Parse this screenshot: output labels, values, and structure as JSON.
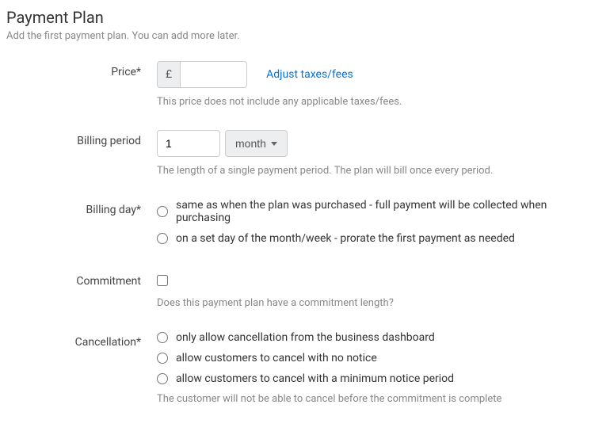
{
  "header": {
    "title": "Payment Plan",
    "subtitle": "Add the first payment plan. You can add more later."
  },
  "price": {
    "label": "Price*",
    "currency": "£",
    "value": "",
    "adjust_link": "Adjust taxes/fees",
    "helper": "This price does not include any applicable taxes/fees."
  },
  "billing_period": {
    "label": "Billing period",
    "value": "1",
    "unit": "month",
    "helper": "The length of a single payment period. The plan will bill once every period."
  },
  "billing_day": {
    "label": "Billing day*",
    "options": [
      "same as when the plan was purchased - full payment will be collected when purchasing",
      "on a set day of the month/week - prorate the first payment as needed"
    ]
  },
  "commitment": {
    "label": "Commitment",
    "helper": "Does this payment plan have a commitment length?"
  },
  "cancellation": {
    "label": "Cancellation*",
    "options": [
      "only allow cancellation from the business dashboard",
      "allow customers to cancel with no notice",
      "allow customers to cancel with a minimum notice period"
    ],
    "helper": "The customer will not be able to cancel before the commitment is complete"
  }
}
